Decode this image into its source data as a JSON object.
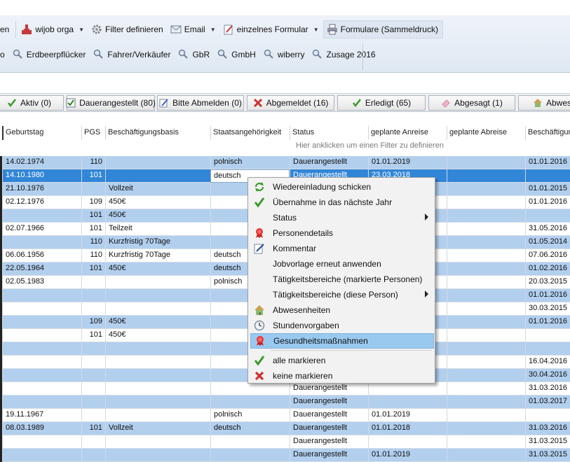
{
  "toolbar": {
    "row1": {
      "partial_label": "en",
      "wijob_orga": "wijob orga",
      "filter_define": "Filter definieren",
      "email": "Email",
      "single_form": "einzelnes Formular",
      "forms_bulk": "Formulare (Sammeldruck)"
    },
    "row2": {
      "partial_label": "o",
      "searches": [
        "Erdbeerpflücker",
        "Fahrer/Verkäufer",
        "GbR",
        "GmbH",
        "wiberry",
        "Zusage 2016"
      ]
    }
  },
  "filters": [
    {
      "label": "Aktiv (0)",
      "icon": "check-icon"
    },
    {
      "label": "Dauerangestellt (80)",
      "icon": "checkbox-icon"
    },
    {
      "label": "Bitte Abmelden (0)",
      "icon": "edit-icon"
    },
    {
      "label": "Abgemeldet (16)",
      "icon": "x-icon"
    },
    {
      "label": "Erledigt (65)",
      "icon": "check-icon"
    },
    {
      "label": "Abgesagt (1)",
      "icon": "eraser-icon"
    },
    {
      "label": "Abwese",
      "icon": "house-icon"
    }
  ],
  "table": {
    "columns": [
      "Geburtstag",
      "PGS",
      "Beschäftigungsbasis",
      "Staatsangehörigkeit",
      "Status",
      "geplante Anreise",
      "geplante Abreise",
      "Beschäftigun"
    ],
    "filter_hint": "Hier anklicken um einen Filter zu definieren",
    "rows": [
      {
        "c": [
          "14.02.1974",
          "110",
          "",
          "polnisch",
          "Dauerangestellt",
          "01.01.2019",
          "",
          "01.01.2016"
        ],
        "style": "blue"
      },
      {
        "c": [
          "14.10.1980",
          "101",
          "",
          "deutsch",
          "Dauerangestellt",
          "23.03.2018",
          "",
          ""
        ],
        "style": "sel"
      },
      {
        "c": [
          "21.10.1976",
          "",
          "Vollzeit",
          "",
          "",
          "",
          "",
          "01.01.2015"
        ],
        "style": "blue"
      },
      {
        "c": [
          "02.12.1976",
          "109",
          "450€",
          "",
          "",
          "",
          "",
          "01.01.2016"
        ],
        "style": "white"
      },
      {
        "c": [
          "",
          "101",
          "450€",
          "",
          "",
          "",
          "",
          ""
        ],
        "style": "blue"
      },
      {
        "c": [
          "02.07.1966",
          "101",
          "Teilzeit",
          "",
          "",
          "",
          "",
          "31.05.2016"
        ],
        "style": "white"
      },
      {
        "c": [
          "",
          "110",
          "Kurzfristig 70Tage",
          "",
          "",
          "",
          "",
          "01.05.2014"
        ],
        "style": "blue"
      },
      {
        "c": [
          "06.06.1956",
          "110",
          "Kurzfristig 70Tage",
          "deutsch",
          "",
          "",
          "",
          "07.06.2016"
        ],
        "style": "white"
      },
      {
        "c": [
          "22.05.1964",
          "101",
          "450€",
          "deutsch",
          "",
          "",
          "",
          "01.02.2016"
        ],
        "style": "blue"
      },
      {
        "c": [
          "02.05.1983",
          "",
          "",
          "polnisch",
          "",
          "",
          "",
          "20.03.2015"
        ],
        "style": "white"
      },
      {
        "c": [
          "",
          "",
          "",
          "",
          "",
          "",
          "",
          "01.01.2016"
        ],
        "style": "blue"
      },
      {
        "c": [
          "",
          "",
          "",
          "",
          "",
          "",
          "",
          "30.03.2015"
        ],
        "style": "white"
      },
      {
        "c": [
          "",
          "109",
          "450€",
          "",
          "",
          "",
          "",
          "01.01.2016"
        ],
        "style": "blue"
      },
      {
        "c": [
          "",
          "101",
          "450€",
          "",
          "",
          "",
          "",
          ""
        ],
        "style": "white"
      },
      {
        "c": [
          "",
          "",
          "",
          "",
          "",
          "",
          "",
          ""
        ],
        "style": "blue"
      },
      {
        "c": [
          "",
          "",
          "",
          "",
          "",
          "",
          "",
          "16.04.2016"
        ],
        "style": "white"
      },
      {
        "c": [
          "",
          "",
          "",
          "",
          "",
          "",
          "",
          "30.04.2016"
        ],
        "style": "blue"
      },
      {
        "c": [
          "",
          "",
          "",
          "",
          "Dauerangestellt",
          "",
          "",
          "31.03.2016"
        ],
        "style": "white"
      },
      {
        "c": [
          "",
          "",
          "",
          "",
          "Dauerangestellt",
          "",
          "",
          "01.03.2017"
        ],
        "style": "blue"
      },
      {
        "c": [
          "19.11.1967",
          "",
          "",
          "polnisch",
          "Dauerangestellt",
          "01.01.2019",
          "",
          ""
        ],
        "style": "white"
      },
      {
        "c": [
          "08.03.1989",
          "101",
          "Vollzeit",
          "deutsch",
          "Dauerangestellt",
          "01.01.2018",
          "",
          "31.03.2016"
        ],
        "style": "blue"
      },
      {
        "c": [
          "",
          "",
          "",
          "",
          "Dauerangestellt",
          "",
          "",
          "31.03.2015"
        ],
        "style": "white"
      },
      {
        "c": [
          "",
          "",
          "",
          "",
          "Dauerangestellt",
          "01.01.2019",
          "",
          "31.03.2015"
        ],
        "style": "blue"
      }
    ]
  },
  "context_menu": {
    "items": [
      {
        "label": "Wiedereinladung schicken",
        "icon": "refresh-icon"
      },
      {
        "label": "Übernahme in das nächste Jahr",
        "icon": "check-icon"
      },
      {
        "label": "Status",
        "icon": "",
        "submenu": true
      },
      {
        "label": "Personendetails",
        "icon": "ribbon-badge-icon"
      },
      {
        "label": "Kommentar",
        "icon": "pencil-icon"
      },
      {
        "label": "Jobvorlage erneut anwenden",
        "icon": ""
      },
      {
        "label": "Tätigkeitsbereiche (markierte Personen)",
        "icon": ""
      },
      {
        "label": "Tätigkeitsbereiche (diese Person)",
        "icon": "",
        "submenu": true
      },
      {
        "label": "Abwesenheiten",
        "icon": "house-icon"
      },
      {
        "label": "Stundenvorgaben",
        "icon": "clock-icon"
      },
      {
        "label": "Gesundheitsmaßnahmen",
        "icon": "ribbon-badge-icon",
        "highlighted": true
      },
      {
        "label": "alle markieren",
        "icon": "check-icon"
      },
      {
        "label": "keine markieren",
        "icon": "x-icon"
      }
    ]
  },
  "colors": {
    "row_blue": "#b2cfee",
    "row_selected": "#3286d8",
    "menu_highlight": "#99c9ef"
  }
}
